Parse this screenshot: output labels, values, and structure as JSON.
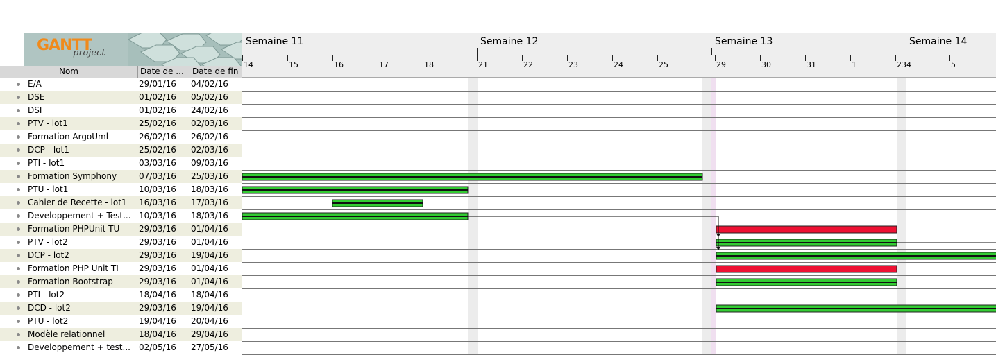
{
  "logo": {
    "text": "GANTT",
    "subtext": "project"
  },
  "columns": {
    "name": "Nom",
    "start": "Date de ...",
    "end": "Date de fin"
  },
  "weeks": [
    "Semaine 11",
    "Semaine 12",
    "Semaine 13",
    "Semaine 14"
  ],
  "days": [
    "14",
    "15",
    "16",
    "17",
    "18",
    "21",
    "22",
    "23",
    "24",
    "25",
    "29",
    "30",
    "31",
    "1",
    "234",
    "5"
  ],
  "tasks": [
    {
      "name": "E/A",
      "start": "29/01/16",
      "end": "04/02/16"
    },
    {
      "name": "DSE",
      "start": "01/02/16",
      "end": "05/02/16"
    },
    {
      "name": "DSI",
      "start": "01/02/16",
      "end": "24/02/16"
    },
    {
      "name": "PTV - lot1",
      "start": "25/02/16",
      "end": "02/03/16"
    },
    {
      "name": "Formation ArgoUml",
      "start": "26/02/16",
      "end": "26/02/16"
    },
    {
      "name": "DCP - lot1",
      "start": "25/02/16",
      "end": "02/03/16"
    },
    {
      "name": "PTI - lot1",
      "start": "03/03/16",
      "end": "09/03/16"
    },
    {
      "name": "Formation Symphony",
      "start": "07/03/16",
      "end": "25/03/16"
    },
    {
      "name": "PTU - lot1",
      "start": "10/03/16",
      "end": "18/03/16"
    },
    {
      "name": "Cahier de Recette - lot1",
      "start": "16/03/16",
      "end": "17/03/16"
    },
    {
      "name": "Developpement + Test...",
      "start": "10/03/16",
      "end": "18/03/16"
    },
    {
      "name": "Formation PHPUnit TU",
      "start": "29/03/16",
      "end": "01/04/16"
    },
    {
      "name": "PTV - lot2",
      "start": "29/03/16",
      "end": "01/04/16"
    },
    {
      "name": "DCP - lot2",
      "start": "29/03/16",
      "end": "19/04/16"
    },
    {
      "name": "Formation PHP Unit TI",
      "start": "29/03/16",
      "end": "01/04/16"
    },
    {
      "name": "Formation Bootstrap",
      "start": "29/03/16",
      "end": "01/04/16"
    },
    {
      "name": "PTI - lot2",
      "start": "18/04/16",
      "end": "18/04/16"
    },
    {
      "name": "DCD - lot2",
      "start": "29/03/16",
      "end": "19/04/16"
    },
    {
      "name": "PTU - lot2",
      "start": "19/04/16",
      "end": "20/04/16"
    },
    {
      "name": "Modèle relationnel",
      "start": "18/04/16",
      "end": "29/04/16"
    },
    {
      "name": "Developpement + test...",
      "start": "02/05/16",
      "end": "27/05/16"
    }
  ],
  "colors": {
    "normal_bar": "#33cc33",
    "critical_bar": "#ee1133",
    "bar_border": "#222222"
  }
}
